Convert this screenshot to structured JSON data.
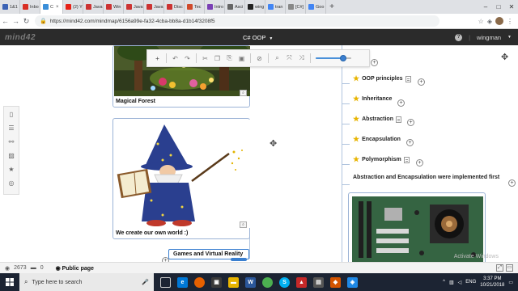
{
  "browser": {
    "tabs": [
      {
        "label": "1&1",
        "color": "#3a62b5"
      },
      {
        "label": "Inbo",
        "color": "#d93025"
      },
      {
        "label": "C",
        "color": "#3a8fd9",
        "active": true
      },
      {
        "label": "(2) Y",
        "color": "#e62117"
      },
      {
        "label": "Java",
        "color": "#c33"
      },
      {
        "label": "Win",
        "color": "#c33"
      },
      {
        "label": "Java",
        "color": "#c33"
      },
      {
        "label": "Java",
        "color": "#c33"
      },
      {
        "label": "Disc",
        "color": "#c33"
      },
      {
        "label": "Tec",
        "color": "#d04a2c"
      },
      {
        "label": "Intro",
        "color": "#7a3fb5"
      },
      {
        "label": "Asci",
        "color": "#666"
      },
      {
        "label": "wing",
        "color": "#222"
      },
      {
        "label": "tran",
        "color": "#4285f4"
      },
      {
        "label": "[C#]",
        "color": "#888"
      },
      {
        "label": "Goo",
        "color": "#4285f4"
      }
    ],
    "new_tab_label": "+",
    "url": "https://mind42.com/mindmap/6156a99e-fa32-4cba-bb8a-d1b14f3208f5"
  },
  "app": {
    "logo": "mind42",
    "map_title": "C# OOP",
    "user": "wingman"
  },
  "map": {
    "image_nodes": [
      {
        "label": "Magical Forest"
      },
      {
        "label": "We create our own world :)"
      }
    ],
    "topics": [
      {
        "label": "OOP principles"
      },
      {
        "label": "Inheritance"
      },
      {
        "label": "Abstraction"
      },
      {
        "label": "Encapsulation"
      },
      {
        "label": "Polymorphism"
      }
    ],
    "note_text": "Abstraction and Encapsulation were implemented first",
    "selected_node": "Games and Virtual Reality"
  },
  "statusbar": {
    "views": "2673",
    "comments": "0",
    "visibility": "Public page"
  },
  "watermark": "Activate Windows",
  "taskbar": {
    "search_placeholder": "Type here to search",
    "lang": "ENG",
    "time": "3:37 PM",
    "date": "10/21/2018"
  },
  "colors": {
    "accent": "#3a7fd0",
    "star": "#e8b400",
    "app_bar": "#2b2b2b"
  }
}
